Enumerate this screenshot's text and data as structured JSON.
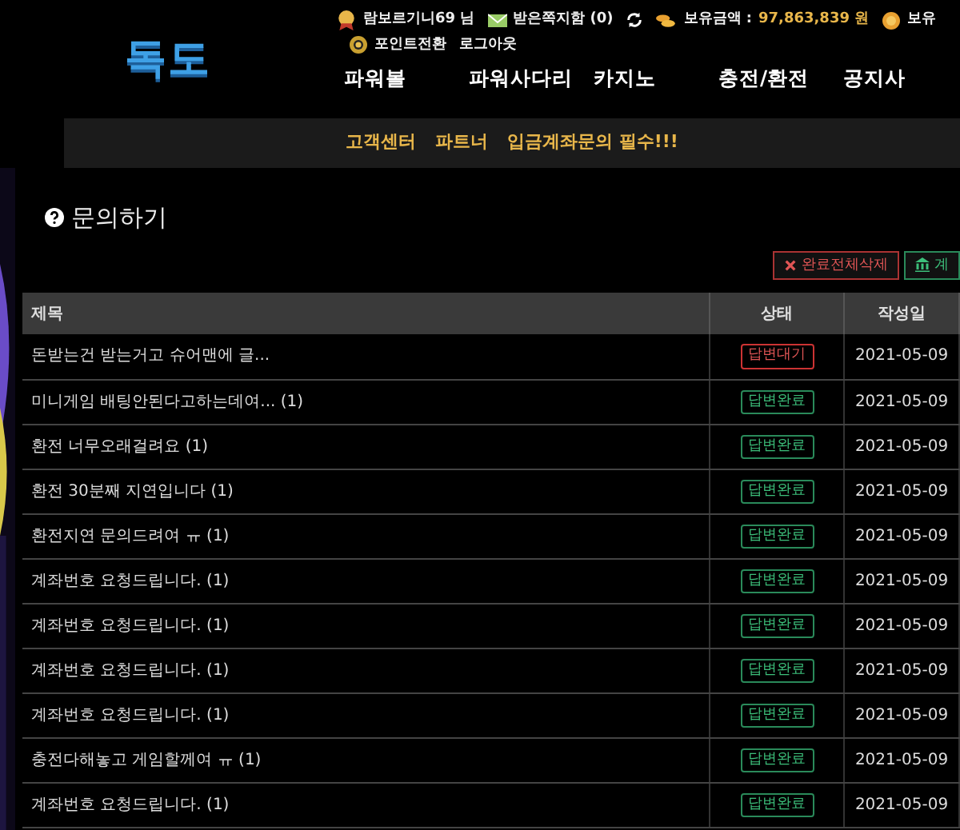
{
  "header": {
    "logo": "독도",
    "user": "람보르기니69 님",
    "messages": "받은쪽지함 (0)",
    "balance_label": "보유금액 :",
    "balance": "97,863,839 원",
    "points_label": "보유",
    "point_convert": "포인트전환",
    "logout": "로그아웃"
  },
  "nav": [
    "파워볼",
    "파워사다리",
    "카지노",
    "충전/환전",
    "공지사"
  ],
  "subnav": [
    "고객센터",
    "파트너",
    "입금계좌문의 필수!!!"
  ],
  "page_title": "문의하기",
  "actions": [
    {
      "label": "완료전체삭제",
      "kind": "delete"
    },
    {
      "label": "계",
      "kind": "account"
    }
  ],
  "table": {
    "columns": [
      "제목",
      "상태",
      "작성일"
    ],
    "rows": [
      {
        "title": "돈받는건 받는거고 슈어맨에 글...",
        "status": "답변대기",
        "answered": false,
        "date": "2021-05-09"
      },
      {
        "title": "미니게임 배팅안된다고하는데여... (1)",
        "status": "답변완료",
        "answered": true,
        "date": "2021-05-09"
      },
      {
        "title": "환전 너무오래걸려요 (1)",
        "status": "답변완료",
        "answered": true,
        "date": "2021-05-09"
      },
      {
        "title": "환전 30분째 지연입니다 (1)",
        "status": "답변완료",
        "answered": true,
        "date": "2021-05-09"
      },
      {
        "title": "환전지연 문의드려여 ㅠ (1)",
        "status": "답변완료",
        "answered": true,
        "date": "2021-05-09"
      },
      {
        "title": "계좌번호 요청드립니다. (1)",
        "status": "답변완료",
        "answered": true,
        "date": "2021-05-09"
      },
      {
        "title": "계좌번호 요청드립니다. (1)",
        "status": "답변완료",
        "answered": true,
        "date": "2021-05-09"
      },
      {
        "title": "계좌번호 요청드립니다. (1)",
        "status": "답변완료",
        "answered": true,
        "date": "2021-05-09"
      },
      {
        "title": "계좌번호 요청드립니다. (1)",
        "status": "답변완료",
        "answered": true,
        "date": "2021-05-09"
      },
      {
        "title": "충전다해놓고 게임할께여 ㅠ (1)",
        "status": "답변완료",
        "answered": true,
        "date": "2021-05-09"
      },
      {
        "title": "계좌번호 요청드립니다. (1)",
        "status": "답변완료",
        "answered": true,
        "date": "2021-05-09"
      }
    ]
  }
}
